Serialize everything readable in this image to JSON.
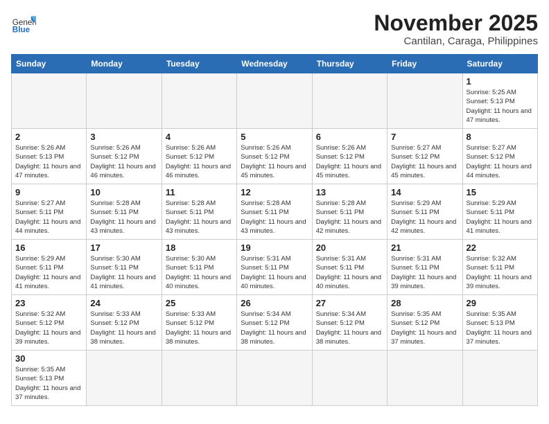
{
  "header": {
    "logo_general": "General",
    "logo_blue": "Blue",
    "month_title": "November 2025",
    "location": "Cantilan, Caraga, Philippines"
  },
  "days_of_week": [
    "Sunday",
    "Monday",
    "Tuesday",
    "Wednesday",
    "Thursday",
    "Friday",
    "Saturday"
  ],
  "weeks": [
    [
      {
        "day": "",
        "empty": true
      },
      {
        "day": "",
        "empty": true
      },
      {
        "day": "",
        "empty": true
      },
      {
        "day": "",
        "empty": true
      },
      {
        "day": "",
        "empty": true
      },
      {
        "day": "",
        "empty": true
      },
      {
        "day": "1",
        "sunrise": "5:25 AM",
        "sunset": "5:13 PM",
        "daylight": "11 hours and 47 minutes."
      }
    ],
    [
      {
        "day": "2",
        "sunrise": "5:26 AM",
        "sunset": "5:13 PM",
        "daylight": "11 hours and 47 minutes."
      },
      {
        "day": "3",
        "sunrise": "5:26 AM",
        "sunset": "5:12 PM",
        "daylight": "11 hours and 46 minutes."
      },
      {
        "day": "4",
        "sunrise": "5:26 AM",
        "sunset": "5:12 PM",
        "daylight": "11 hours and 46 minutes."
      },
      {
        "day": "5",
        "sunrise": "5:26 AM",
        "sunset": "5:12 PM",
        "daylight": "11 hours and 45 minutes."
      },
      {
        "day": "6",
        "sunrise": "5:26 AM",
        "sunset": "5:12 PM",
        "daylight": "11 hours and 45 minutes."
      },
      {
        "day": "7",
        "sunrise": "5:27 AM",
        "sunset": "5:12 PM",
        "daylight": "11 hours and 45 minutes."
      },
      {
        "day": "8",
        "sunrise": "5:27 AM",
        "sunset": "5:12 PM",
        "daylight": "11 hours and 44 minutes."
      }
    ],
    [
      {
        "day": "9",
        "sunrise": "5:27 AM",
        "sunset": "5:11 PM",
        "daylight": "11 hours and 44 minutes."
      },
      {
        "day": "10",
        "sunrise": "5:28 AM",
        "sunset": "5:11 PM",
        "daylight": "11 hours and 43 minutes."
      },
      {
        "day": "11",
        "sunrise": "5:28 AM",
        "sunset": "5:11 PM",
        "daylight": "11 hours and 43 minutes."
      },
      {
        "day": "12",
        "sunrise": "5:28 AM",
        "sunset": "5:11 PM",
        "daylight": "11 hours and 43 minutes."
      },
      {
        "day": "13",
        "sunrise": "5:28 AM",
        "sunset": "5:11 PM",
        "daylight": "11 hours and 42 minutes."
      },
      {
        "day": "14",
        "sunrise": "5:29 AM",
        "sunset": "5:11 PM",
        "daylight": "11 hours and 42 minutes."
      },
      {
        "day": "15",
        "sunrise": "5:29 AM",
        "sunset": "5:11 PM",
        "daylight": "11 hours and 41 minutes."
      }
    ],
    [
      {
        "day": "16",
        "sunrise": "5:29 AM",
        "sunset": "5:11 PM",
        "daylight": "11 hours and 41 minutes."
      },
      {
        "day": "17",
        "sunrise": "5:30 AM",
        "sunset": "5:11 PM",
        "daylight": "11 hours and 41 minutes."
      },
      {
        "day": "18",
        "sunrise": "5:30 AM",
        "sunset": "5:11 PM",
        "daylight": "11 hours and 40 minutes."
      },
      {
        "day": "19",
        "sunrise": "5:31 AM",
        "sunset": "5:11 PM",
        "daylight": "11 hours and 40 minutes."
      },
      {
        "day": "20",
        "sunrise": "5:31 AM",
        "sunset": "5:11 PM",
        "daylight": "11 hours and 40 minutes."
      },
      {
        "day": "21",
        "sunrise": "5:31 AM",
        "sunset": "5:11 PM",
        "daylight": "11 hours and 39 minutes."
      },
      {
        "day": "22",
        "sunrise": "5:32 AM",
        "sunset": "5:11 PM",
        "daylight": "11 hours and 39 minutes."
      }
    ],
    [
      {
        "day": "23",
        "sunrise": "5:32 AM",
        "sunset": "5:12 PM",
        "daylight": "11 hours and 39 minutes."
      },
      {
        "day": "24",
        "sunrise": "5:33 AM",
        "sunset": "5:12 PM",
        "daylight": "11 hours and 38 minutes."
      },
      {
        "day": "25",
        "sunrise": "5:33 AM",
        "sunset": "5:12 PM",
        "daylight": "11 hours and 38 minutes."
      },
      {
        "day": "26",
        "sunrise": "5:34 AM",
        "sunset": "5:12 PM",
        "daylight": "11 hours and 38 minutes."
      },
      {
        "day": "27",
        "sunrise": "5:34 AM",
        "sunset": "5:12 PM",
        "daylight": "11 hours and 38 minutes."
      },
      {
        "day": "28",
        "sunrise": "5:35 AM",
        "sunset": "5:12 PM",
        "daylight": "11 hours and 37 minutes."
      },
      {
        "day": "29",
        "sunrise": "5:35 AM",
        "sunset": "5:13 PM",
        "daylight": "11 hours and 37 minutes."
      }
    ],
    [
      {
        "day": "30",
        "sunrise": "5:35 AM",
        "sunset": "5:13 PM",
        "daylight": "11 hours and 37 minutes."
      },
      {
        "day": "",
        "empty": true
      },
      {
        "day": "",
        "empty": true
      },
      {
        "day": "",
        "empty": true
      },
      {
        "day": "",
        "empty": true
      },
      {
        "day": "",
        "empty": true
      },
      {
        "day": "",
        "empty": true
      }
    ]
  ],
  "labels": {
    "sunrise_prefix": "Sunrise: ",
    "sunset_prefix": "Sunset: ",
    "daylight_prefix": "Daylight: "
  }
}
